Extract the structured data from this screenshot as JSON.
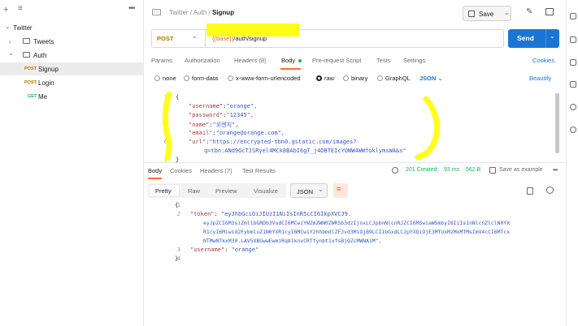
{
  "sidebar": {
    "collection": "Twitter",
    "folders": [
      {
        "name": "Tweets"
      },
      {
        "name": "Auth"
      }
    ],
    "requests": [
      {
        "method": "POST",
        "name": "Signup"
      },
      {
        "method": "POST",
        "name": "Login"
      },
      {
        "method": "GET",
        "name": "Me"
      }
    ]
  },
  "header": {
    "breadcrumb": {
      "workspace": "Twitter",
      "folder": "Auth",
      "request": "Signup"
    },
    "save_label": "Save"
  },
  "request": {
    "method": "POST",
    "url_var": "{{base}}",
    "url_path": "/auth/signup",
    "send_label": "Send",
    "tabs": [
      "Params",
      "Authorization",
      "Headers (8)",
      "Body",
      "Pre-request Script",
      "Tests",
      "Settings"
    ],
    "active_tab": "Body",
    "cookies_label": "Cookies",
    "body_types": [
      "none",
      "form-data",
      "x-www-form-urlencoded",
      "raw",
      "binary",
      "GraphQL"
    ],
    "selected_body_type": "raw",
    "format": "JSON",
    "beautify_label": "Beautify",
    "body_lines": [
      {
        "n": "1",
        "text": "{"
      },
      {
        "n": "2",
        "key": "\"username\"",
        "val": "\"orange\","
      },
      {
        "n": "3",
        "key": "\"password\"",
        "val": "\"12345\","
      },
      {
        "n": "4",
        "key": "\"name\"",
        "val": "\"오렌지\","
      },
      {
        "n": "5",
        "key": "\"email\"",
        "val": "\"orange@orange.com\","
      },
      {
        "n": "6",
        "key": "\"url\"",
        "val": "\"https://encrypted-tbn0.gstatic.com/images?"
      },
      {
        "n": "",
        "text": "q=tbn:ANd9GcTJSRyel4MCk8BAbI6gT_j4DBTEIcYOWW4WWfoklymsWA&s\""
      },
      {
        "n": "7",
        "text": "}"
      }
    ]
  },
  "response": {
    "tabs": [
      "Body",
      "Cookies",
      "Headers (7)",
      "Test Results"
    ],
    "active_tab": "Body",
    "status": "201 Created",
    "time": "93 ms",
    "size": "562 B",
    "save_example_label": "Save as example",
    "view_modes": [
      "Pretty",
      "Raw",
      "Preview",
      "Visualize"
    ],
    "active_view": "Pretty",
    "format": "JSON",
    "lines": [
      {
        "n": "1",
        "text": "{"
      },
      {
        "n": "2",
        "key": "\"token\"",
        "val": "\"eyJhbGciOiJIUzI1NiIsInR5cCI6IkpXVCJ9."
      },
      {
        "n": "",
        "val": "eyJpZCI6M3siZmllbGRDb3VudCI6MCwiYWZmZWN0ZWRSb3dzIjoxLCJpbnNlcnRJZCI6MSwiaW5mbyI6IiIsInNlcnZlclN0YX"
      },
      {
        "n": "",
        "val": "R1cyI6Miwid2FybmluZ1N0YXR1cyI6MCwiY2hhbmdlZFJvd3MiOjB9LCI1bGxdLCJpYXQiOjE3MTUxMzMxMTMsImV4cCI6MTcx"
      },
      {
        "n": "",
        "val": "NTMwNTkxM30.LAV5XBGwwEwmiRq81knvCRTfynbt1xfsBjQZcMWNA1M\","
      },
      {
        "n": "3",
        "key": "\"username\"",
        "val": "\"orange\""
      },
      {
        "n": "4",
        "text": "}"
      }
    ]
  }
}
